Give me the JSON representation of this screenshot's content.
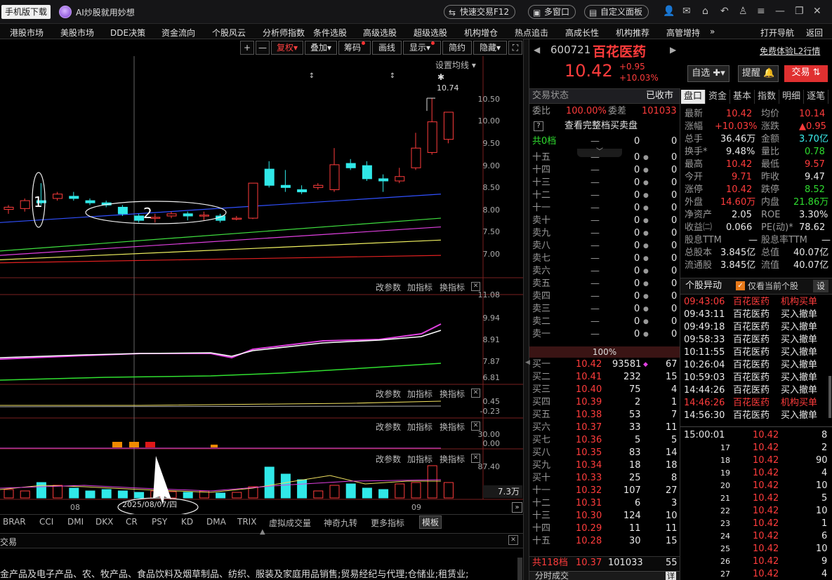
{
  "topbar": {
    "download": "手机版下载",
    "ai_text": "AI炒股就用妙想",
    "quick_trade": "快速交易F12",
    "multi_window": "多窗口",
    "custom_panel": "自定义面板"
  },
  "menu": [
    "港股市场",
    "美股市场",
    "DDE决策",
    "资金流向",
    "个股风云",
    "分析师指数",
    "条件选股",
    "高级选股",
    "超级选股",
    "机构增仓",
    "热点追击",
    "高成长性",
    "机构推荐",
    "高管增持",
    "»",
    "打开导航",
    "返回"
  ],
  "chart_toolbar": {
    "plus": "+",
    "minus": "—",
    "fuquan": "复权",
    "overlay": "叠加",
    "chips": "筹码",
    "draw": "画线",
    "display": "显示",
    "simple": "简约",
    "hide": "隐藏",
    "expand": "⛶"
  },
  "chart": {
    "set_ma": "设置均线",
    "peak_label": "10.74",
    "annot1": "1",
    "annot2": "2",
    "price_ticks": [
      "10.50",
      "10.00",
      "9.50",
      "9.00",
      "8.50",
      "8.00",
      "7.50",
      "7.00"
    ],
    "macd_ticks": [
      "11.08",
      "9.94",
      "8.91",
      "7.87",
      "6.81"
    ],
    "p3_ticks": [
      "0.45",
      "-0.23"
    ],
    "p4_ticks": [
      "30.00",
      "0.00"
    ],
    "p5_ticks": [
      "87.40"
    ],
    "vol_label": "7.3万",
    "panel_btns": [
      "改参数",
      "加指标",
      "换指标"
    ],
    "x_labels": [
      "08",
      "09"
    ],
    "selected_date": "2025/08/07/四"
  },
  "chart_data": {
    "type": "candlestick",
    "ylim": [
      6.8,
      10.9
    ],
    "candles": [
      [
        8.2,
        8.25,
        8.1,
        8.3
      ],
      [
        8.22,
        8.4,
        8.15,
        8.45
      ],
      [
        8.4,
        8.35,
        8.3,
        8.8
      ],
      [
        8.45,
        8.55,
        8.4,
        8.6
      ],
      [
        8.5,
        8.45,
        8.4,
        8.6
      ],
      [
        8.4,
        8.35,
        8.3,
        8.45
      ],
      [
        8.35,
        8.3,
        8.25,
        8.4
      ],
      [
        8.25,
        8.1,
        8.05,
        8.3
      ],
      [
        8.05,
        7.95,
        7.9,
        8.1
      ],
      [
        8.0,
        8.02,
        7.9,
        8.1
      ],
      [
        8.05,
        8.1,
        8.0,
        8.15
      ],
      [
        8.1,
        8.05,
        7.95,
        8.15
      ],
      [
        8.05,
        8.07,
        7.95,
        8.15
      ],
      [
        8.05,
        7.95,
        7.9,
        8.1
      ],
      [
        7.98,
        8.0,
        7.95,
        8.05
      ],
      [
        8.0,
        8.8,
        7.98,
        8.8
      ],
      [
        9.12,
        8.75,
        8.7,
        9.3
      ],
      [
        8.75,
        8.7,
        8.6,
        9.1
      ],
      [
        8.65,
        8.6,
        8.55,
        8.75
      ],
      [
        8.7,
        8.75,
        8.65,
        8.8
      ],
      [
        8.65,
        9.22,
        8.6,
        9.6
      ],
      [
        9.25,
        9.15,
        9.1,
        9.35
      ],
      [
        9.2,
        8.9,
        8.85,
        9.3
      ],
      [
        8.9,
        8.85,
        8.6,
        9.0
      ],
      [
        8.85,
        8.95,
        8.8,
        9.15
      ],
      [
        9.15,
        9.6,
        9.1,
        9.95
      ],
      [
        9.5,
        10.2,
        9.45,
        10.74
      ],
      [
        9.8,
        10.42,
        9.71,
        10.42
      ]
    ],
    "ma_lines": [
      {
        "color": "#3050ff",
        "values": [
          7.9,
          8.55
        ]
      },
      {
        "color": "#40e040",
        "values": [
          7.25,
          8.0
        ]
      },
      {
        "color": "#e040e0",
        "values": [
          7.15,
          7.8
        ]
      },
      {
        "color": "#f0f060",
        "values": [
          7.05,
          7.5
        ]
      },
      {
        "color": "#e02020",
        "values": [
          6.98,
          7.15
        ]
      }
    ]
  },
  "indicators": [
    "BRAR",
    "CCI",
    "DMI",
    "DKX",
    "CR",
    "PSY",
    "KD",
    "DMA",
    "TRIX",
    "虚拟成交量",
    "神奇九转",
    "更多指标",
    "模板"
  ],
  "bottom": {
    "trade": "交易",
    "desc": "金产品及电子产品、农、牧产品、食品饮料及烟草制品、纺织、服装及家庭用品销售;贸易经纪与代理;仓储业;租赁业;"
  },
  "quote": {
    "code": "600721",
    "name": "百花医药",
    "free": "免费体验L2行情",
    "price": "10.42",
    "change": "+0.95",
    "pct": "+10.03%",
    "watch": "自选",
    "alert": "提醒",
    "trade": "交易"
  },
  "status": {
    "label": "交易状态",
    "value": "已收市",
    "ratio_l": "委比",
    "ratio": "100.00%",
    "diff_l": "委差",
    "diff": "101033",
    "full": "查看完整档买卖盘",
    "total0": "共0档",
    "pct100": "100%"
  },
  "sells": [
    "十五",
    "十四",
    "十三",
    "十二",
    "十一",
    "卖十",
    "卖九",
    "卖八",
    "卖七",
    "卖六",
    "卖五",
    "卖四",
    "卖三",
    "卖二",
    "卖一"
  ],
  "buys": [
    [
      "买一",
      "10.42",
      "93581",
      "67"
    ],
    [
      "买二",
      "10.41",
      "232",
      "15"
    ],
    [
      "买三",
      "10.40",
      "75",
      "4"
    ],
    [
      "买四",
      "10.39",
      "2",
      "1"
    ],
    [
      "买五",
      "10.38",
      "53",
      "7"
    ],
    [
      "买六",
      "10.37",
      "33",
      "11"
    ],
    [
      "买七",
      "10.36",
      "5",
      "5"
    ],
    [
      "买八",
      "10.35",
      "83",
      "14"
    ],
    [
      "买九",
      "10.34",
      "18",
      "18"
    ],
    [
      "买十",
      "10.33",
      "25",
      "8"
    ],
    [
      "十一",
      "10.32",
      "107",
      "27"
    ],
    [
      "十二",
      "10.31",
      "6",
      "3"
    ],
    [
      "十三",
      "10.30",
      "124",
      "10"
    ],
    [
      "十四",
      "10.29",
      "11",
      "11"
    ],
    [
      "十五",
      "10.28",
      "30",
      "15"
    ]
  ],
  "buy_total": [
    "共118档",
    "10.37",
    "101033",
    "55"
  ],
  "tabs": [
    "盘口",
    "资金",
    "基本",
    "指数",
    "明细",
    "逐笔"
  ],
  "stats": [
    [
      "最新",
      "10.42",
      "均价",
      "10.14"
    ],
    [
      "涨幅",
      "+10.03%",
      "涨跌",
      "▲0.95"
    ],
    [
      "总手",
      "36.46万",
      "金额",
      "3.70亿"
    ],
    [
      "换手*",
      "9.48%",
      "量比",
      "0.78"
    ],
    [
      "最高",
      "10.42",
      "最低",
      "9.57"
    ],
    [
      "今开",
      "9.71",
      "昨收",
      "9.47"
    ],
    [
      "涨停",
      "10.42",
      "跌停",
      "8.52"
    ],
    [
      "外盘",
      "14.60万",
      "内盘",
      "21.86万"
    ],
    [
      "净资产",
      "2.05",
      "ROE",
      "3.30%"
    ],
    [
      "收益㈡",
      "0.066",
      "PE(动)*",
      "78.62"
    ],
    [
      "股息TTM",
      "—",
      "股息率TTM",
      "—"
    ],
    [
      "总股本",
      "3.845亿",
      "总值",
      "40.07亿"
    ],
    [
      "流通股",
      "3.845亿",
      "流值",
      "40.07亿"
    ]
  ],
  "movers": {
    "title": "个股异动",
    "only": "仅看当前个股",
    "set": "设",
    "rows": [
      [
        "09:43:06",
        "百花医药",
        "机构买单"
      ],
      [
        "09:43:11",
        "百花医药",
        "买入撤单"
      ],
      [
        "09:49:18",
        "百花医药",
        "买入撤单"
      ],
      [
        "09:58:33",
        "百花医药",
        "买入撤单"
      ],
      [
        "10:11:55",
        "百花医药",
        "买入撤单"
      ],
      [
        "10:26:04",
        "百花医药",
        "买入撤单"
      ],
      [
        "10:59:03",
        "百花医药",
        "买入撤单"
      ],
      [
        "14:44:26",
        "百花医药",
        "买入撤单"
      ],
      [
        "14:46:26",
        "百花医药",
        "机构买单"
      ],
      [
        "14:56:30",
        "百花医药",
        "买入撤单"
      ]
    ]
  },
  "ticks": [
    [
      "15:00:01",
      "10.42",
      "8"
    ],
    [
      "17",
      "10.42",
      "2"
    ],
    [
      "18",
      "10.42",
      "90"
    ],
    [
      "19",
      "10.42",
      "4"
    ],
    [
      "20",
      "10.42",
      "10"
    ],
    [
      "21",
      "10.42",
      "5"
    ],
    [
      "22",
      "10.42",
      "10"
    ],
    [
      "23",
      "10.42",
      "1"
    ],
    [
      "24",
      "10.42",
      "6"
    ],
    [
      "25",
      "10.42",
      "10"
    ],
    [
      "26",
      "10.42",
      "9"
    ],
    [
      "27",
      "10.42",
      "4"
    ]
  ],
  "fenshi": "分时成交",
  "detail": "详"
}
